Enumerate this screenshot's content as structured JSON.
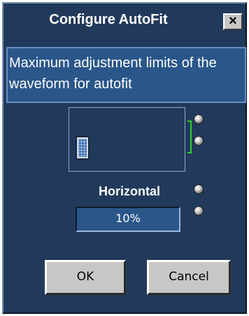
{
  "dialog": {
    "title": "Configure AutoFit",
    "close_label": "×",
    "description": "Maximum adjustment limits of the waveform for autofit",
    "axis_label": "Horizontal",
    "horizontal_value": "10%",
    "ok_label": "OK",
    "cancel_label": "Cancel"
  },
  "icons": {
    "knobs": [
      "knob-icon",
      "knob-icon",
      "knob-icon",
      "knob-icon"
    ],
    "waveform": "waveform-icon",
    "bracket": "vertical-bracket-icon"
  },
  "colors": {
    "background": "#213a5c",
    "field": "#2a568a",
    "bracket": "#2fd02f",
    "button": "#c7c7c7"
  }
}
